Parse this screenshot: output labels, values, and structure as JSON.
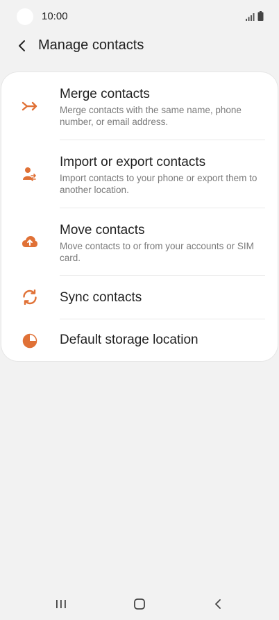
{
  "status_bar": {
    "time": "10:00"
  },
  "header": {
    "title": "Manage contacts",
    "back_icon": "chevron-left-icon"
  },
  "accent_color": "#e07136",
  "menu": {
    "items": [
      {
        "title": "Merge contacts",
        "description": "Merge contacts with the same name, phone number, or email address.",
        "icon": "merge-icon"
      },
      {
        "title": "Import or export contacts",
        "description": "Import contacts to your phone or export them to another location.",
        "icon": "import-export-icon"
      },
      {
        "title": "Move contacts",
        "description": "Move contacts to or from your accounts or SIM card.",
        "icon": "cloud-upload-icon"
      },
      {
        "title": "Sync contacts",
        "icon": "sync-icon"
      },
      {
        "title": "Default storage location",
        "icon": "storage-icon"
      }
    ]
  },
  "nav_bar": {
    "icons": [
      "recent-apps-icon",
      "home-icon",
      "back-icon"
    ]
  }
}
